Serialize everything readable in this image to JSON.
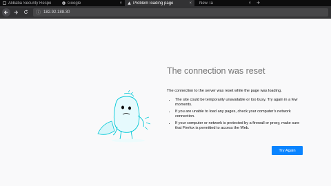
{
  "tabs": [
    {
      "title": "Alibaba Security Respo",
      "icon": "page-icon",
      "active": false
    },
    {
      "title": "Google",
      "icon": "google-icon",
      "active": false
    },
    {
      "title": "Problem loading page",
      "icon": "warning-icon",
      "active": true
    },
    {
      "title": "New Ta",
      "icon": "none",
      "active": false
    }
  ],
  "new_tab_label": "+",
  "urlbar": {
    "url": "182.92.188.30"
  },
  "error": {
    "title": "The connection was reset",
    "intro": "The connection to the server was reset while the page was loading.",
    "reasons": [
      "The site could be temporarily unavailable or too busy. Try again in a few moments.",
      "If you are unable to load any pages, check your computer’s network connection.",
      "If your computer or network is protected by a firewall or proxy, make sure that Firefox is permitted to access the Web."
    ],
    "button_label": "Try Again"
  },
  "colors": {
    "accent": "#0a84ff",
    "title": "#737373",
    "tabbar": "#0c0c0d",
    "toolbar": "#323234"
  }
}
